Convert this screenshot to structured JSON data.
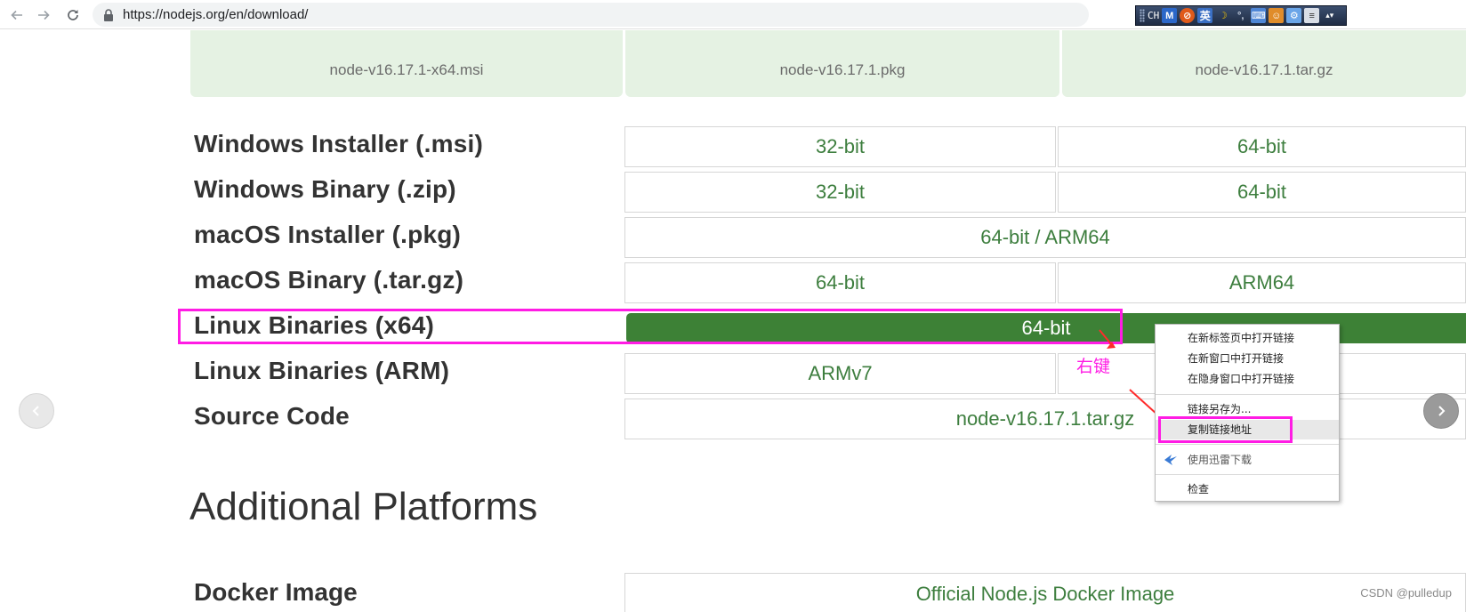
{
  "browser": {
    "url": "https://nodejs.org/en/download/",
    "ime_bar": {
      "lang": "CH",
      "icons": [
        "m-icon",
        "no-entry-icon",
        "english-mode-icon",
        "moon-icon",
        "punctuation-icon",
        "keyboard-icon",
        "skin-icon",
        "toolbox-icon",
        "settings-icon",
        "menu-icon"
      ],
      "english_char": "英"
    }
  },
  "download_tiles": [
    {
      "label": "node-v16.17.1-x64.msi"
    },
    {
      "label": "node-v16.17.1.pkg"
    },
    {
      "label": "node-v16.17.1.tar.gz"
    }
  ],
  "downloads_table": [
    {
      "label": "Windows Installer (.msi)",
      "cells": [
        "32-bit",
        "64-bit"
      ]
    },
    {
      "label": "Windows Binary (.zip)",
      "cells": [
        "32-bit",
        "64-bit"
      ]
    },
    {
      "label": "macOS Installer (.pkg)",
      "cells": [
        "64-bit / ARM64"
      ]
    },
    {
      "label": "macOS Binary (.tar.gz)",
      "cells": [
        "64-bit",
        "ARM64"
      ]
    },
    {
      "label": "Linux Binaries (x64)",
      "cells": [
        "64-bit"
      ],
      "active": true
    },
    {
      "label": "Linux Binaries (ARM)",
      "cells": [
        "ARMv7",
        ""
      ]
    },
    {
      "label": "Source Code",
      "cells": [
        "node-v16.17.1.tar.gz"
      ]
    }
  ],
  "additional": {
    "title": "Additional Platforms",
    "docker_label": "Docker Image",
    "docker_link": "Official Node.js Docker Image"
  },
  "annotation": {
    "right_click_text": "右键",
    "color": "#ff1ce4"
  },
  "context_menu": {
    "items": [
      {
        "label": "在新标签页中打开链接"
      },
      {
        "label": "在新窗口中打开链接"
      },
      {
        "label": "在隐身窗口中打开链接"
      },
      {
        "label": "链接另存为..."
      },
      {
        "label": "复制链接地址",
        "selected": true
      },
      {
        "label": "使用迅雷下载",
        "icon": "thunder-bird-icon"
      },
      {
        "label": "检查"
      }
    ]
  },
  "colors": {
    "accent_green": "#3d8136",
    "link_green": "#3d7e3e",
    "tile_bg": "#e5f2e3"
  },
  "watermark": "CSDN @pulledup"
}
